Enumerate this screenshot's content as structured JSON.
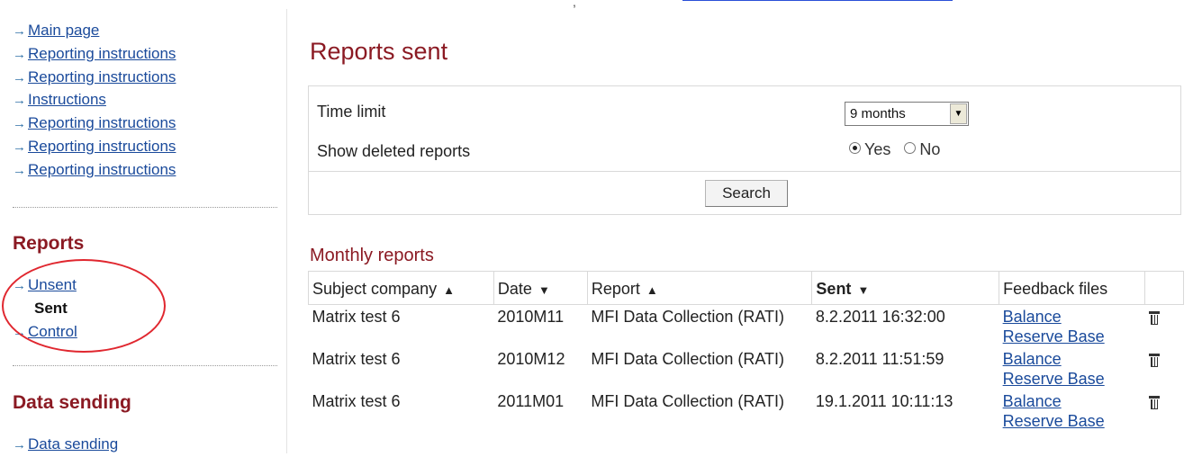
{
  "top_stub": {
    "text": ","
  },
  "sidebar": {
    "nav_items": [
      {
        "label": "Main page"
      },
      {
        "label": "Reporting instructions"
      },
      {
        "label": "Reporting instructions"
      },
      {
        "label": "Instructions"
      },
      {
        "label": "Reporting instructions"
      },
      {
        "label": "Reporting instructions"
      },
      {
        "label": "Reporting instructions"
      }
    ],
    "reports_title": "Reports",
    "reports_items": [
      {
        "label": "Unsent"
      },
      {
        "label": "Sent"
      },
      {
        "label": "Control"
      }
    ],
    "data_sending_title": "Data sending",
    "data_sending_items": [
      {
        "label": "Data sending"
      }
    ]
  },
  "main": {
    "title": "Reports sent",
    "filters": {
      "time_limit_label": "Time limit",
      "time_limit_value": "9 months",
      "show_deleted_label": "Show deleted reports",
      "yes_label": "Yes",
      "no_label": "No",
      "selected": "Yes",
      "search_label": "Search"
    },
    "monthly_title": "Monthly reports",
    "table": {
      "columns": [
        {
          "label": "Subject company",
          "sort": "▲"
        },
        {
          "label": "Date",
          "sort": "▼"
        },
        {
          "label": "Report",
          "sort": "▲"
        },
        {
          "label": "Sent",
          "sort": "▼"
        },
        {
          "label": "Feedback files",
          "sort": ""
        }
      ],
      "rows": [
        {
          "company": "Matrix test 6",
          "date": "2010M11",
          "report": "MFI Data Collection (RATI)",
          "sent": "8.2.2011 16:32:00",
          "files": [
            "Balance",
            "Reserve Base"
          ]
        },
        {
          "company": "Matrix test 6",
          "date": "2010M12",
          "report": "MFI Data Collection (RATI)",
          "sent": "8.2.2011 11:51:59",
          "files": [
            "Balance",
            "Reserve Base"
          ]
        },
        {
          "company": "Matrix test 6",
          "date": "2011M01",
          "report": "MFI Data Collection (RATI)",
          "sent": "19.1.2011 10:11:13",
          "files": [
            "Balance",
            "Reserve Base"
          ]
        }
      ]
    }
  },
  "colors": {
    "heading": "#8b1a23",
    "link": "#1a4a9b",
    "highlight_circle": "#e0272f"
  }
}
